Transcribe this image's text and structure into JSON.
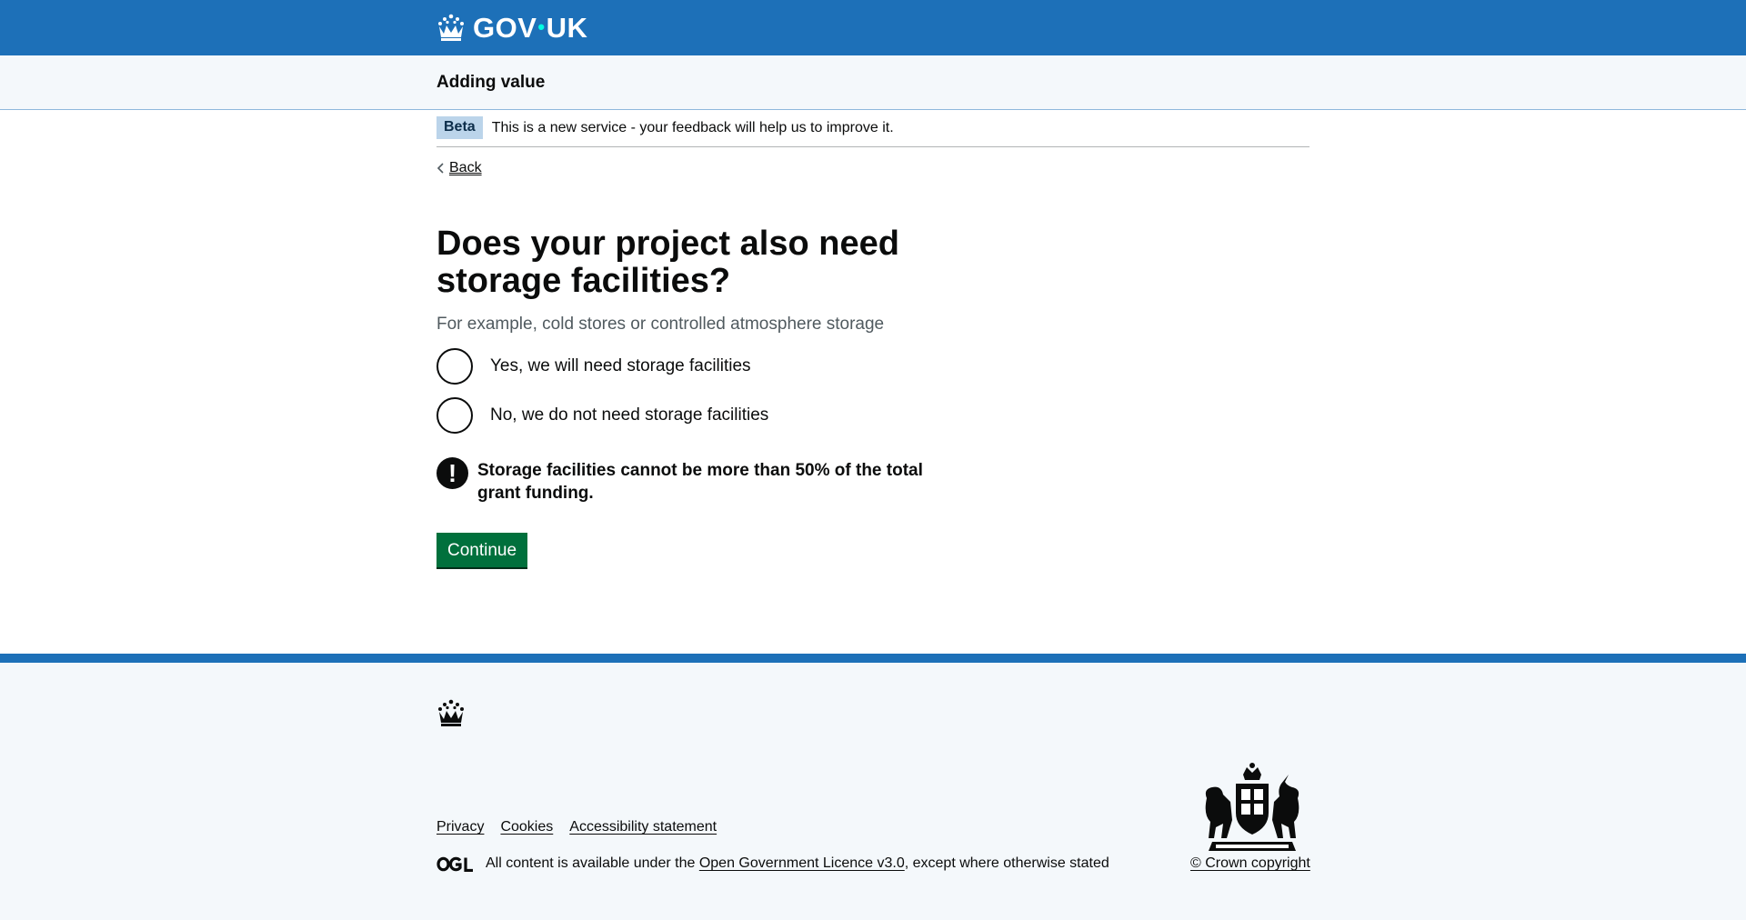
{
  "header": {
    "logo_text": "GOV",
    "logo_dot": "•",
    "logo_text_2": "UK",
    "logo_icon": "crown-icon",
    "background_color": "#1d70b8"
  },
  "service": {
    "name": "Adding value"
  },
  "phase_banner": {
    "tag": "Beta",
    "text": "This is a new service - your feedback will help us to improve it."
  },
  "back_link": {
    "label": "Back",
    "icon": "chevron-left-icon"
  },
  "question": {
    "title": "Does your project also need storage facilities?",
    "hint": "For example, cold stores or controlled atmosphere storage",
    "options": [
      {
        "label": "Yes, we will need storage facilities",
        "selected": false
      },
      {
        "label": "No, we do not need storage facilities",
        "selected": false
      }
    ]
  },
  "warning": {
    "icon_text": "!",
    "text": "Storage facilities cannot be more than 50% of the total grant funding."
  },
  "continue_button": {
    "label": "Continue",
    "color": "#00703c"
  },
  "footer": {
    "links": [
      "Privacy",
      "Cookies",
      "Accessibility statement"
    ],
    "licence_prefix": "All content is available under the ",
    "licence_link": "Open Government Licence v3.0",
    "licence_suffix": ", except where otherwise stated",
    "copyright": "© Crown copyright"
  }
}
